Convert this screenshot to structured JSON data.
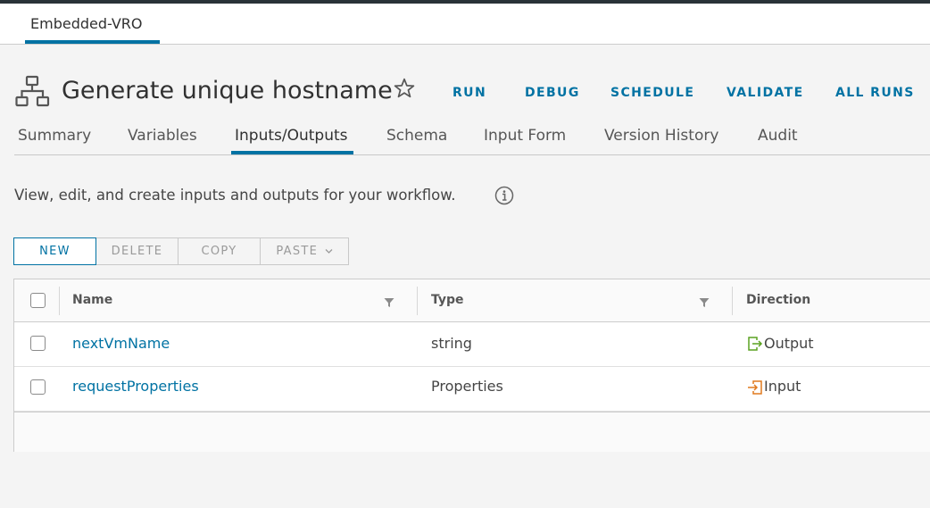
{
  "top_tab": {
    "label": "Embedded-VRO"
  },
  "workflow": {
    "title": "Generate unique hostname"
  },
  "actions": [
    {
      "label": "RUN"
    },
    {
      "label": "DEBUG"
    },
    {
      "label": "SCHEDULE"
    },
    {
      "label": "VALIDATE"
    },
    {
      "label": "ALL RUNS"
    }
  ],
  "tabs": [
    {
      "label": "Summary"
    },
    {
      "label": "Variables"
    },
    {
      "label": "Inputs/Outputs",
      "active": true
    },
    {
      "label": "Schema"
    },
    {
      "label": "Input Form"
    },
    {
      "label": "Version History"
    },
    {
      "label": "Audit"
    }
  ],
  "description": "View, edit, and create inputs and outputs for your workflow.",
  "toolbar": {
    "new": "NEW",
    "delete": "DELETE",
    "copy": "COPY",
    "paste": "PASTE"
  },
  "table": {
    "columns": [
      "Name",
      "Type",
      "Direction"
    ],
    "rows": [
      {
        "name": "nextVmName",
        "type": "string",
        "direction": "Output",
        "direction_icon": "output-icon"
      },
      {
        "name": "requestProperties",
        "type": "Properties",
        "direction": "Input",
        "direction_icon": "input-icon"
      }
    ]
  },
  "colors": {
    "accent": "#0072a3",
    "output_icon": "#5aa220",
    "input_icon": "#e07a1f"
  }
}
